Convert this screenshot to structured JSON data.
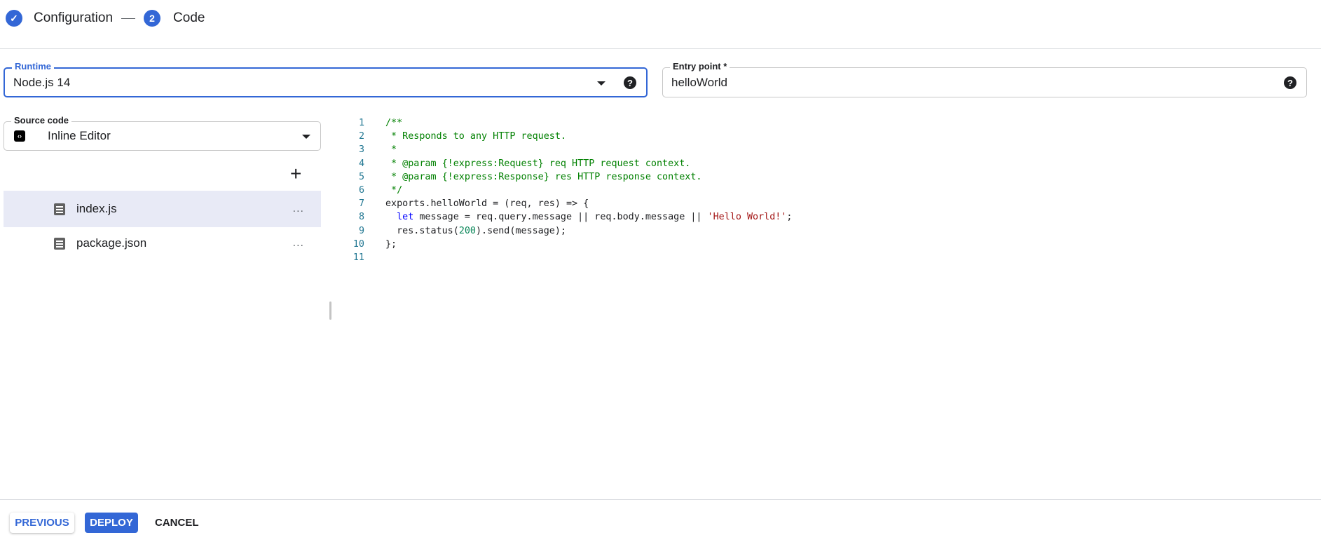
{
  "stepper": {
    "steps": [
      {
        "label": "Configuration",
        "status": "done"
      },
      {
        "number": "2",
        "label": "Code",
        "status": "active"
      }
    ]
  },
  "runtime": {
    "label": "Runtime",
    "value": "Node.js 14"
  },
  "entry_point": {
    "label": "Entry point *",
    "value": "helloWorld"
  },
  "source_code": {
    "label": "Source code",
    "value": "Inline Editor"
  },
  "files": [
    {
      "name": "index.js",
      "selected": true
    },
    {
      "name": "package.json",
      "selected": false
    }
  ],
  "more_label": "...",
  "add_label": "+",
  "help_label": "?",
  "code_lines": [
    [
      [
        "cm",
        "/**"
      ]
    ],
    [
      [
        "cm",
        " * Responds to any HTTP request."
      ]
    ],
    [
      [
        "cm",
        " *"
      ]
    ],
    [
      [
        "cm",
        " * @param {!express:Request} req HTTP request context."
      ]
    ],
    [
      [
        "cm",
        " * @param {!express:Response} res HTTP response context."
      ]
    ],
    [
      [
        "cm",
        " */"
      ]
    ],
    [
      [
        "",
        "exports.helloWorld = (req, res) => {"
      ]
    ],
    [
      [
        "",
        "  "
      ],
      [
        "kw",
        "let"
      ],
      [
        "",
        " message = req.query.message || req.body.message || "
      ],
      [
        "st",
        "'Hello World!'"
      ],
      [
        "",
        ";"
      ]
    ],
    [
      [
        "",
        "  res.status("
      ],
      [
        "nu",
        "200"
      ],
      [
        "",
        ").send(message);"
      ]
    ],
    [
      [
        "",
        "};"
      ]
    ],
    [
      [
        "",
        ""
      ]
    ]
  ],
  "footer": {
    "previous": "PREVIOUS",
    "deploy": "DEPLOY",
    "cancel": "CANCEL"
  },
  "colors": {
    "accent": "#3367d6"
  }
}
